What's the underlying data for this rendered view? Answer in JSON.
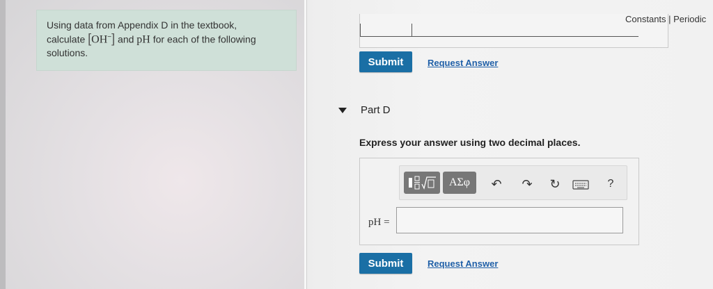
{
  "problem": {
    "text_1": "Using data from Appendix D in the textbook,",
    "text_2": "calculate",
    "formula": "OH",
    "formula_charge": "−",
    "text_3": "and",
    "ph": "pH",
    "text_4": "for each of the following",
    "text_5": "solutions."
  },
  "header": {
    "constants_link": "Constants | Periodic"
  },
  "part_c": {
    "submit_label": "Submit",
    "request_label": "Request Answer"
  },
  "part_d": {
    "title": "Part D",
    "instruction": "Express your answer using two decimal places.",
    "toolbar": {
      "template_icon": "fraction-sqrt-icon",
      "symbols_label": "ΑΣφ",
      "undo_icon": "undo-icon",
      "redo_icon": "redo-icon",
      "reset_icon": "reset-icon",
      "keyboard_icon": "keyboard-icon",
      "help_label": "?"
    },
    "answer_label": "pH =",
    "answer_value": "",
    "submit_label": "Submit",
    "request_label": "Request Answer"
  },
  "colors": {
    "submit_bg": "#1a6fa5",
    "link": "#2060a8",
    "problem_bg": "#cfe0d8",
    "toolbar_button": "#777777"
  }
}
